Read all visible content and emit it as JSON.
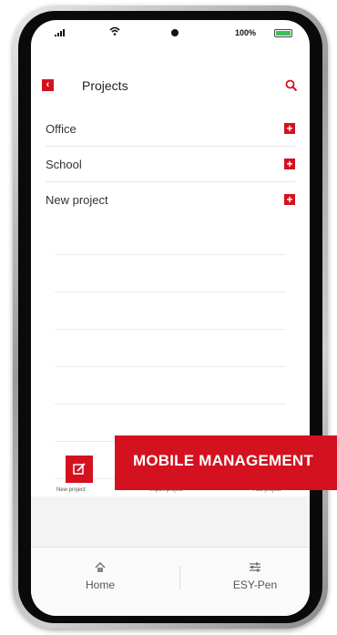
{
  "status": {
    "battery": "100%"
  },
  "header": {
    "title": "Projects"
  },
  "projects": [
    {
      "label": "Office"
    },
    {
      "label": "School"
    },
    {
      "label": "New project"
    }
  ],
  "actions": {
    "new_project": "New project",
    "import_project": "Import project",
    "add_project": "Add project"
  },
  "tabs": [
    {
      "label": "Home",
      "icon": "home-icon"
    },
    {
      "label": "ESY-Pen",
      "icon": "sliders-icon"
    }
  ],
  "banner": {
    "text": "MOBILE MANAGEMENT"
  },
  "colors": {
    "accent": "#d4121f",
    "battery": "#3cbf5a"
  }
}
